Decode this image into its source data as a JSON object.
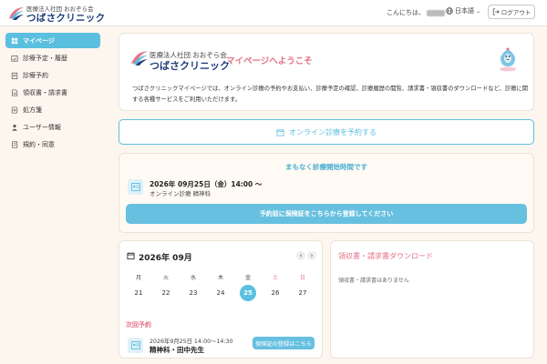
{
  "header": {
    "org_label": "医療法人社団 おおぞら会",
    "clinic_name": "つばさクリニック",
    "greeting": "こんにちは、",
    "language": "日本語",
    "logout_label": "ログアウト"
  },
  "sidebar": {
    "items": [
      {
        "label": "マイページ",
        "icon": "home-icon",
        "active": true
      },
      {
        "label": "診療予定・履歴",
        "icon": "calendar-check-icon",
        "active": false
      },
      {
        "label": "診療予約",
        "icon": "clipboard-icon",
        "active": false
      },
      {
        "label": "領収書・請求書",
        "icon": "document-icon",
        "active": false
      },
      {
        "label": "処方箋",
        "icon": "prescription-icon",
        "active": false
      },
      {
        "label": "ユーザー情報",
        "icon": "user-icon",
        "active": false
      },
      {
        "label": "規約・同意",
        "icon": "document-list-icon",
        "active": false
      }
    ]
  },
  "welcome": {
    "org_label": "医療法人社団 おおぞら会",
    "clinic_name": "つばさクリニック",
    "title": "マイページへようこそ",
    "description": "つばさクリニックマイページでは、オンライン診療の予約やお支払い、診療予定の確認、診療履歴の閲覧、請求書・領収書のダウンロードなど、診療に関する各種サービスをご利用いただけます。"
  },
  "reserve_button": {
    "label": "オンライン診療を予約する"
  },
  "upcoming": {
    "title": "まもなく診療開始時間です",
    "date": "2026年 09月25日（金）14:00 〜",
    "type": "オンライン診療 精神科",
    "insurance_button": "予約前に保険証をこちらから登録してください"
  },
  "calendar": {
    "title": "2026年 09月",
    "weekdays": [
      "月",
      "火",
      "水",
      "木",
      "金",
      "土",
      "日"
    ],
    "days": [
      "21",
      "22",
      "23",
      "24",
      "25",
      "26",
      "27"
    ],
    "today_index": 4,
    "next_label": "次回予約",
    "next_time": "2026年9月25日 14:00〜14:30",
    "next_doctor": "精神科・田中先生",
    "insurance_button": "保険証の登録はこちら"
  },
  "receipts": {
    "title": "領収書・請求書ダウンロード",
    "empty_text": "領収書・請求書はありません"
  },
  "colors": {
    "accent": "#5bbfe0",
    "pink": "#e57389",
    "navy": "#1f3d7a",
    "background": "#fdf6ee"
  }
}
